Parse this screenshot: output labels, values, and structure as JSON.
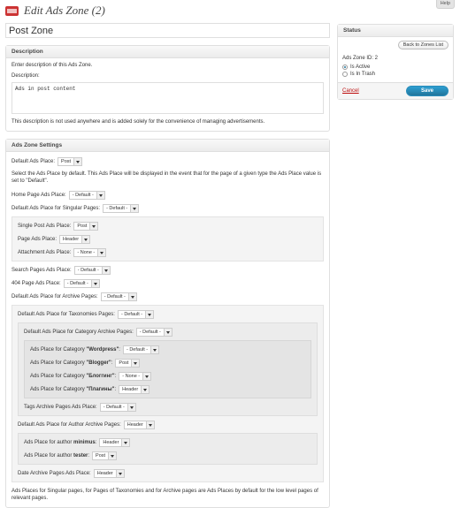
{
  "help_tab": "Help",
  "page_title": "Edit Ads Zone (2)",
  "zone_name": "Post Zone",
  "description": {
    "title": "Description",
    "intro": "Enter description of this Ads Zone.",
    "label": "Description:",
    "value": "Ads in post content",
    "note": "This description is not used anywhere and is added solely for the convenience of managing advertisements."
  },
  "settings": {
    "title": "Ads Zone Settings",
    "default_label": "Default Ads Place:",
    "default_value": "Post",
    "default_help": "Select the Ads Place by default. This Ads Place will be displayed in the event that for the page of a given type the Ads Place value is set to \"Default\".",
    "home_label": "Home Page Ads Place:",
    "home_value": "- Default -",
    "singular_label": "Default Ads Place for Singular Pages:",
    "singular_value": "- Default -",
    "single_post_label": "Single Post Ads Place:",
    "single_post_value": "Post",
    "page_label": "Page Ads Place:",
    "page_value": "Header",
    "attachment_label": "Attachment Ads Place:",
    "attachment_value": "- None -",
    "search_label": "Search Pages Ads Place:",
    "search_value": "- Default -",
    "notfound_label": "404 Page Ads Place:",
    "notfound_value": "- Default -",
    "archive_label": "Default Ads Place for Archive Pages:",
    "archive_value": "- Default -",
    "taxonomies_label": "Default Ads Place for Taxonomies Pages:",
    "taxonomies_value": "- Default -",
    "category_archive_label": "Default Ads Place for Category Archive Pages:",
    "category_archive_value": "- Default -",
    "category_prefix": "Ads Place for Category ",
    "categories": [
      {
        "name": "\"Wordpress\"",
        "value": "- Default -"
      },
      {
        "name": "\"Blogger\"",
        "value": "Post"
      },
      {
        "name": "\"Блоггинг\"",
        "value": "- None -"
      },
      {
        "name": "\"Плагины\"",
        "value": "Header"
      }
    ],
    "tags_label": "Tags Archive Pages Ads Place:",
    "tags_value": "- Default -",
    "author_archive_label": "Default Ads Place for Author Archive Pages:",
    "author_archive_value": "Header",
    "author_prefix": "Ads Place for author ",
    "authors": [
      {
        "name": "minimus",
        "value": "Header"
      },
      {
        "name": "tester",
        "value": "Post"
      }
    ],
    "date_label": "Date Archive Pages Ads Place:",
    "date_value": "Header",
    "footer_note": "Ads Places for Singular pages, for Pages of Taxonomies and for Archive pages are Ads Places by default for the low level pages of relevant pages."
  },
  "status": {
    "title": "Status",
    "back_button": "Back to Zones List",
    "zone_id": "Ads Zone ID: 2",
    "active_label": "Is Active",
    "trash_label": "Is In Trash",
    "cancel": "Cancel",
    "save": "Save"
  }
}
